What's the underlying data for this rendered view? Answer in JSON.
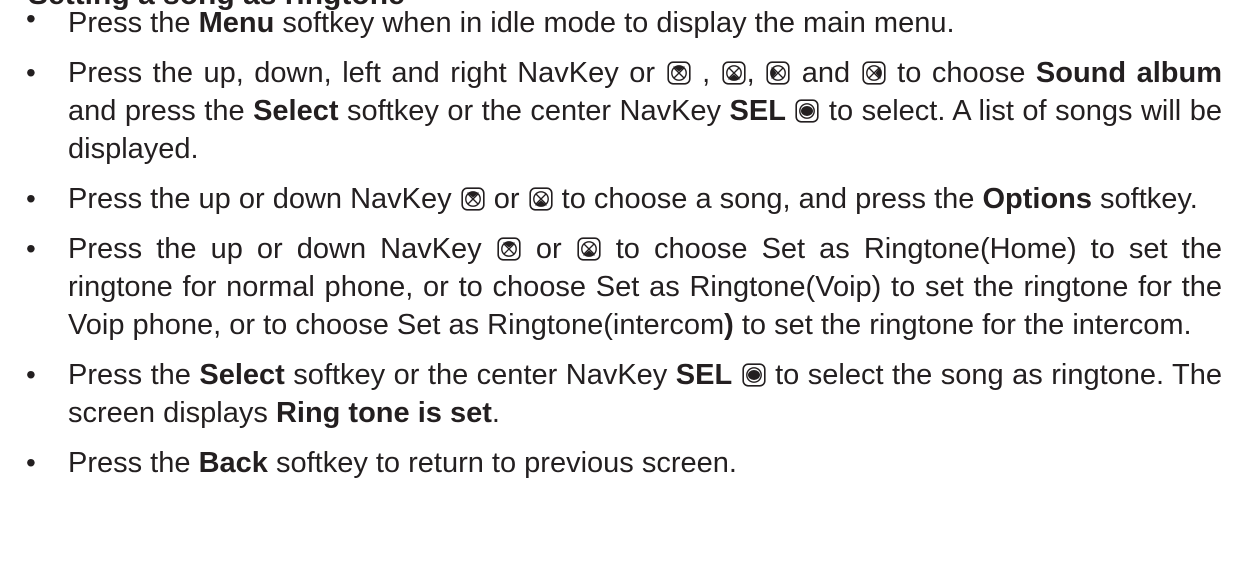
{
  "heading": "Setting a song as ringtone",
  "bullets": [
    {
      "segments": [
        {
          "t": "Press the "
        },
        {
          "t": "Menu",
          "b": true
        },
        {
          "t": " softkey when in idle mode to display the main menu."
        }
      ]
    },
    {
      "segments": [
        {
          "t": "Press the up, down, left and right NavKey or "
        },
        {
          "icon": "navkey-up-icon"
        },
        {
          "t": " , "
        },
        {
          "icon": "navkey-down-icon"
        },
        {
          "t": ", "
        },
        {
          "icon": "navkey-left-icon"
        },
        {
          "t": " and "
        },
        {
          "icon": "navkey-right-icon"
        },
        {
          "t": " to choose "
        },
        {
          "t": "Sound album",
          "b": true
        },
        {
          "t": " and press the "
        },
        {
          "t": "Select",
          "b": true
        },
        {
          "t": " softkey or the center NavKey "
        },
        {
          "t": "SEL",
          "b": true
        },
        {
          "t": " "
        },
        {
          "icon": "navkey-center-icon"
        },
        {
          "t": " to select. A list of songs will be displayed."
        }
      ]
    },
    {
      "segments": [
        {
          "t": "Press the up or down NavKey "
        },
        {
          "icon": "navkey-up-icon"
        },
        {
          "t": " or "
        },
        {
          "icon": "navkey-down-icon"
        },
        {
          "t": " to choose a song, and press the "
        },
        {
          "t": "Options",
          "b": true
        },
        {
          "t": " softkey."
        }
      ]
    },
    {
      "segments": [
        {
          "t": "Press the up or down NavKey "
        },
        {
          "icon": "navkey-up-icon"
        },
        {
          "t": " or "
        },
        {
          "icon": "navkey-down-icon"
        },
        {
          "t": " to choose Set as Ringtone(Home) to set the ringtone for normal phone, or to choose Set as Ringtone(Voip) to set the ringtone for the Voip phone, or to choose Set as Ringtone(intercom"
        },
        {
          "t": ")",
          "b": true
        },
        {
          "t": " to set the ringtone for the intercom."
        }
      ]
    },
    {
      "segments": [
        {
          "t": "Press the "
        },
        {
          "t": "Select",
          "b": true
        },
        {
          "t": " softkey or the center NavKey "
        },
        {
          "t": "SEL",
          "b": true
        },
        {
          "t": " "
        },
        {
          "icon": "navkey-center-icon"
        },
        {
          "t": " to select the song as ringtone. The screen displays "
        },
        {
          "t": "Ring tone is set",
          "b": true
        },
        {
          "t": "."
        }
      ]
    },
    {
      "segments": [
        {
          "t": "Press the "
        },
        {
          "t": "Back",
          "b": true
        },
        {
          "t": " softkey to return to previous screen."
        }
      ]
    }
  ]
}
